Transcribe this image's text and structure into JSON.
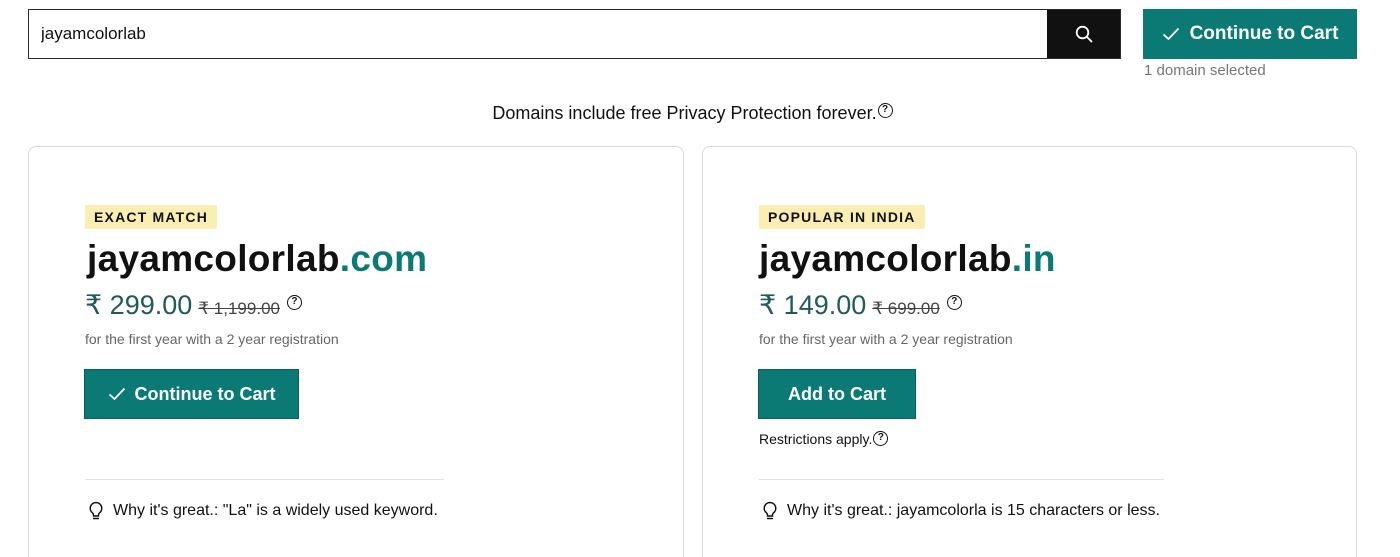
{
  "search": {
    "value": "jayamcolorlab",
    "button_icon": "search-icon"
  },
  "header": {
    "cart_button_label": "Continue to Cart",
    "selected_count": "1 domain selected"
  },
  "privacy_note": "Domains include free Privacy Protection forever.",
  "colors": {
    "accent": "#0b7a75",
    "badge_bg": "#fbeeb3",
    "search_button": "#111111"
  },
  "results": [
    {
      "badge": "EXACT MATCH",
      "domain": "jayamcolorlab",
      "tld": ".com",
      "price": "₹ 299.00",
      "old_price": "₹ 1,199.00",
      "terms": "for the first year with a 2 year registration",
      "button_label": "Continue to Cart",
      "button_icon": "check-icon",
      "why": "Why it's great.: \"La\" is a widely used keyword."
    },
    {
      "badge": "POPULAR IN INDIA",
      "domain": "jayamcolorlab",
      "tld": ".in",
      "price": "₹ 149.00",
      "old_price": "₹ 699.00",
      "terms": "for the first year with a 2 year registration",
      "button_label": "Add to Cart",
      "restrictions": "Restrictions apply.",
      "why": "Why it's great.: jayamcolorla is 15 characters or less."
    }
  ]
}
